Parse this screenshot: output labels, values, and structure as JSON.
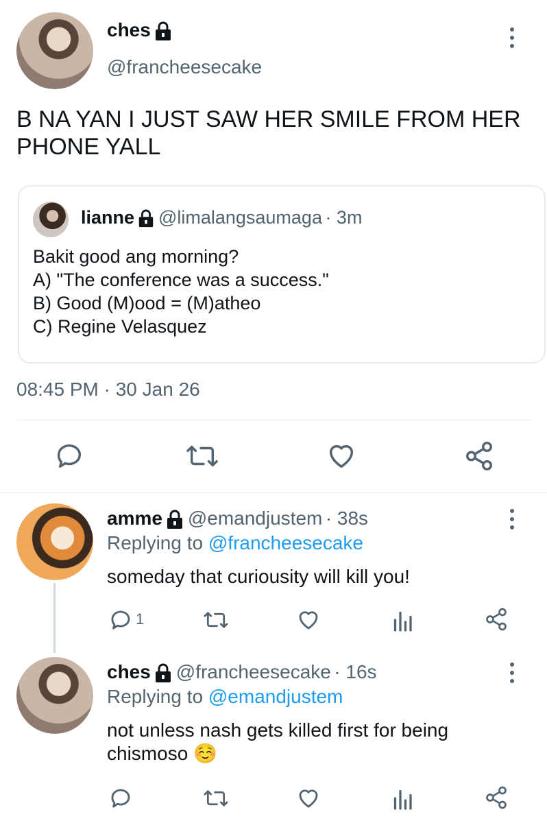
{
  "main_tweet": {
    "display_name": "ches",
    "handle": "@francheesecake",
    "text": "B NA YAN I JUST SAW HER SMILE FROM HER PHONE YALL",
    "timestamp": "08:45 PM · 30 Jan 26"
  },
  "quoted": {
    "display_name": "lianne",
    "handle": "@limalangsaumaga",
    "time": "· 3m",
    "text": "Bakit good ang morning?\nA) \"The conference was a success.\"\nB) Good (M)ood = (M)atheo\nC) Regine Velasquez"
  },
  "replies": [
    {
      "display_name": "amme",
      "handle": "@emandjustem",
      "time": "· 38s",
      "replying_prefix": "Replying to",
      "replying_to": "@francheesecake",
      "text": "someday that curiousity will kill you!",
      "reply_count": "1"
    },
    {
      "display_name": "ches",
      "handle": "@francheesecake",
      "time": "· 16s",
      "replying_prefix": "Replying to",
      "replying_to": "@emandjustem",
      "text": "not unless nash gets killed first for being chismoso ☺️",
      "reply_count": ""
    }
  ],
  "colors": {
    "text": "#0f1419",
    "secondary": "#536471",
    "accent": "#1d9bf0",
    "border": "#e6ecf0"
  },
  "icons": [
    "lock-icon",
    "more-icon",
    "reply-icon",
    "retweet-icon",
    "like-icon",
    "share-icon",
    "analytics-icon"
  ]
}
